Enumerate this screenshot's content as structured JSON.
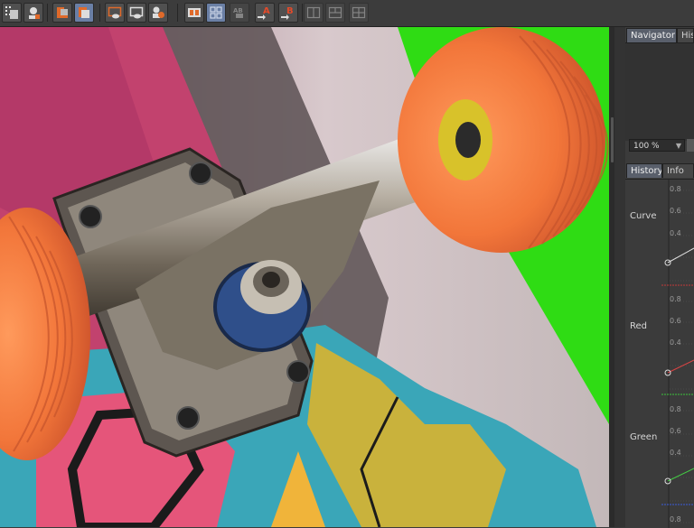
{
  "toolbar": {
    "buttons": [
      {
        "name": "region-render-icon",
        "active": false,
        "dim": false
      },
      {
        "name": "render-view-icon",
        "active": false,
        "dim": false
      },
      {
        "name": "render-queue-icon",
        "active": false,
        "dim": false
      },
      {
        "name": "render-settings-icon",
        "active": true,
        "dim": false
      },
      {
        "name": "snapshot-icon",
        "active": false,
        "dim": false
      },
      {
        "name": "snapshot-view-icon",
        "active": false,
        "dim": false
      },
      {
        "name": "team-render-icon",
        "active": false,
        "dim": false
      },
      {
        "name": "compare-ab-icon",
        "active": false,
        "dim": false
      },
      {
        "name": "compare-grid-icon",
        "active": true,
        "dim": false
      },
      {
        "name": "compare-ab-swap-icon",
        "active": false,
        "dim": true
      },
      {
        "name": "set-a-icon",
        "active": false,
        "dim": false,
        "letter": "A"
      },
      {
        "name": "set-b-icon",
        "active": false,
        "dim": false,
        "letter": "B"
      },
      {
        "name": "layout-split-icon",
        "active": false,
        "dim": true
      },
      {
        "name": "layout-stack-icon",
        "active": false,
        "dim": true
      },
      {
        "name": "layout-grid-icon",
        "active": false,
        "dim": true
      }
    ]
  },
  "panel": {
    "top_tabs": {
      "navigator": "Navigator",
      "history": "History"
    },
    "zoom": {
      "value": "100 %"
    },
    "bottom_tabs": {
      "history": "History",
      "info": "Info"
    },
    "channels": {
      "curve": "Curve",
      "red": "Red",
      "green": "Green"
    },
    "ticks": [
      "0.8",
      "0.6",
      "0.4",
      "0.2",
      "0.0"
    ]
  },
  "colors": {
    "accent": "#6a7fa5",
    "green_screen": "#2fdc14",
    "wheel_orange": "#f07a3c",
    "deck_pink": "#c2426e"
  }
}
